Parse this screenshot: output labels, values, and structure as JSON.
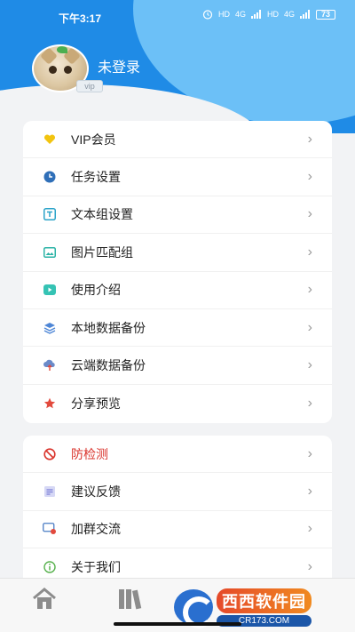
{
  "status_bar": {
    "time": "下午3:17",
    "battery": "73",
    "signal_labels": [
      "HD",
      "4G",
      "HD",
      "4G"
    ]
  },
  "profile": {
    "username": "未登录",
    "vip_tag": "vip"
  },
  "menu_group_1": [
    {
      "label": "VIP会员",
      "icon": "heart-icon",
      "color": "#f2c40f"
    },
    {
      "label": "任务设置",
      "icon": "clock-icon",
      "color": "#2f6fb8"
    },
    {
      "label": "文本组设置",
      "icon": "text-box-icon",
      "color": "#2aa3c9"
    },
    {
      "label": "图片匹配组",
      "icon": "image-icon",
      "color": "#2bb3a6"
    },
    {
      "label": "使用介绍",
      "icon": "video-icon",
      "color": "#35c3b4"
    },
    {
      "label": "本地数据备份",
      "icon": "layers-icon",
      "color": "#4e86d6"
    },
    {
      "label": "云端数据备份",
      "icon": "cloud-upload-icon",
      "color": "#6a8ac9"
    },
    {
      "label": "分享预览",
      "icon": "star-icon",
      "color": "#e24a3d"
    }
  ],
  "menu_group_2": [
    {
      "label": "防检测",
      "icon": "forbidden-icon",
      "color": "#d9322a",
      "text_color": "#d9322a"
    },
    {
      "label": "建议反馈",
      "icon": "feedback-icon",
      "color": "#7d7fd8"
    },
    {
      "label": "加群交流",
      "icon": "group-chat-icon",
      "color": "#4a7cc4"
    },
    {
      "label": "关于我们",
      "icon": "info-icon",
      "color": "#55b04b"
    }
  ],
  "watermark": {
    "title": "西西软件园",
    "subtitle": "CR173.COM"
  },
  "colors": {
    "header_primary": "#1f8be6",
    "header_secondary": "#6cc0f7",
    "chevron": "#9a9a9a"
  }
}
